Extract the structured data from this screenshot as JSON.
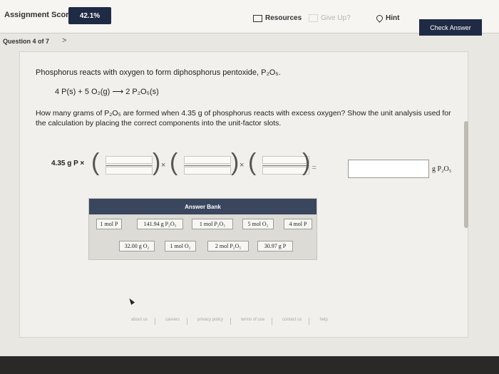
{
  "header": {
    "score_label": "Assignment Score:",
    "score_value": "42.1%",
    "resources_label": "Resources",
    "giveup_label": "Give Up?",
    "hint_label": "Hint",
    "check_label": "Check Answer"
  },
  "nav": {
    "question_label": "Question 4 of 7",
    "next_arrow": ">"
  },
  "problem": {
    "intro": "Phosphorus reacts with oxygen to form diphosphorus pentoxide, P₂O₅.",
    "equation": "4 P(s) + 5 O₂(g) ⟶ 2 P₂O₅(s)",
    "question": "How many grams of P₂O₅ are formed when 4.35 g of phosphorus reacts with excess oxygen? Show the unit analysis used for the calculation by placing the correct components into the unit-factor slots.",
    "start_quantity": "4.35 g P ×",
    "result_unit": "g P₂O₅"
  },
  "answer_bank": {
    "title": "Answer Bank",
    "row1": [
      "1 mol P",
      "141.94 g P₂O₅",
      "1 mol P₂O₅",
      "5 mol O₂",
      "4 mol P"
    ],
    "row2": [
      "32.00 g O₂",
      "1 mol O₂",
      "2 mol P₂O₅",
      "30.97 g P"
    ]
  },
  "footer": [
    "about us",
    "careers",
    "privacy policy",
    "terms of use",
    "contact us",
    "help"
  ]
}
